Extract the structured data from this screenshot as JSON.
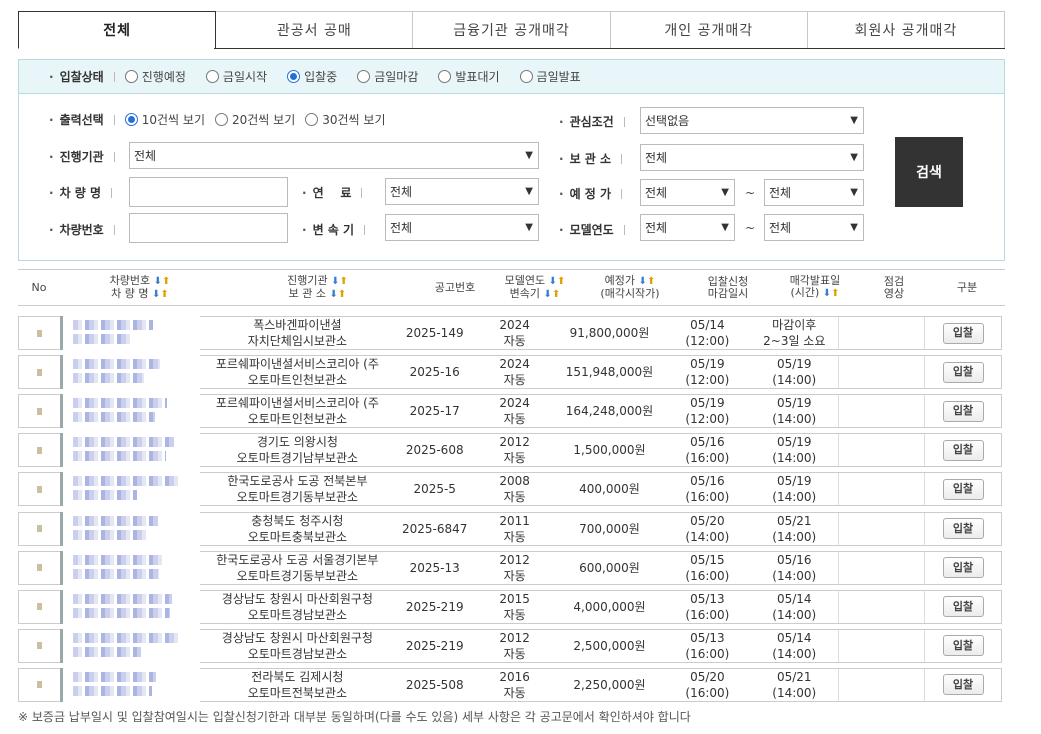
{
  "tabs": [
    "전체",
    "관공서 공매",
    "금융기관 공개매각",
    "개인 공개매각",
    "회원사 공개매각"
  ],
  "status": {
    "label": "입찰상태",
    "options": [
      "진행예정",
      "금일시작",
      "입찰중",
      "금일마감",
      "발표대기",
      "금일발표"
    ],
    "selected": "입찰중"
  },
  "filters": {
    "output_label": "출력선택",
    "output_options": [
      "10건씩 보기",
      "20건씩 보기",
      "30건씩 보기"
    ],
    "output_selected": "10건씩 보기",
    "interest_label": "관심조건",
    "interest_value": "선택없음",
    "agency_label": "진행기관",
    "agency_value": "전체",
    "storage_label": "보 관 소",
    "storage_value": "전체",
    "car_name_label": "차 량 명",
    "fuel_label": "연    료",
    "fuel_value": "전체",
    "price_label": "예 정 가",
    "price_from": "전체",
    "price_to": "전체",
    "car_no_label": "차량번호",
    "gear_label": "변 속 기",
    "gear_value": "전체",
    "model_year_label": "모델연도",
    "year_from": "전체",
    "year_to": "전체",
    "tilde": "~",
    "search_label": "검색"
  },
  "table": {
    "headers": {
      "no": "No",
      "car_no": "차량번호",
      "car_name": "차 량 명",
      "agency": "진행기관",
      "storage": "보 관 소",
      "notice": "공고번호",
      "model_year": "모델연도",
      "gear": "변속기",
      "price": "예정가",
      "price_sub": "(매각시작가)",
      "bid_apply": "입찰신청",
      "deadline": "마감일시",
      "announce": "매각발표일",
      "announce_sub": "(시간)",
      "inspect": "점검",
      "video": "영상",
      "type": "구분"
    },
    "rows": [
      {
        "agency": "폭스바겐파이낸셜",
        "storage": "자치단체임시보관소",
        "notice": "2025-149",
        "year": "2024",
        "gear": "자동",
        "price": "91,800,000원",
        "deadline_date": "05/14",
        "deadline_time": "(12:00)",
        "announce_date": "마감이후",
        "announce_time": "2~3일 소요",
        "button": "입찰"
      },
      {
        "agency": "포르쉐파이낸셜서비스코리아 (주",
        "storage": "오토마트인천보관소",
        "notice": "2025-16",
        "year": "2024",
        "gear": "자동",
        "price": "151,948,000원",
        "deadline_date": "05/19",
        "deadline_time": "(12:00)",
        "announce_date": "05/19",
        "announce_time": "(14:00)",
        "button": "입찰"
      },
      {
        "agency": "포르쉐파이낸셜서비스코리아 (주",
        "storage": "오토마트인천보관소",
        "notice": "2025-17",
        "year": "2024",
        "gear": "자동",
        "price": "164,248,000원",
        "deadline_date": "05/19",
        "deadline_time": "(12:00)",
        "announce_date": "05/19",
        "announce_time": "(14:00)",
        "button": "입찰"
      },
      {
        "agency": "경기도 의왕시청",
        "storage": "오토마트경기남부보관소",
        "notice": "2025-608",
        "year": "2012",
        "gear": "자동",
        "price": "1,500,000원",
        "deadline_date": "05/16",
        "deadline_time": "(16:00)",
        "announce_date": "05/19",
        "announce_time": "(14:00)",
        "button": "입찰"
      },
      {
        "agency": "한국도로공사 도공 전북본부",
        "storage": "오토마트경기동부보관소",
        "notice": "2025-5",
        "year": "2008",
        "gear": "자동",
        "price": "400,000원",
        "deadline_date": "05/16",
        "deadline_time": "(16:00)",
        "announce_date": "05/19",
        "announce_time": "(14:00)",
        "button": "입찰"
      },
      {
        "agency": "충청북도 청주시청",
        "storage": "오토마트충북보관소",
        "notice": "2025-6847",
        "year": "2011",
        "gear": "자동",
        "price": "700,000원",
        "deadline_date": "05/20",
        "deadline_time": "(14:00)",
        "announce_date": "05/21",
        "announce_time": "(14:00)",
        "button": "입찰"
      },
      {
        "agency": "한국도로공사 도공 서울경기본부",
        "storage": "오토마트경기동부보관소",
        "notice": "2025-13",
        "year": "2012",
        "gear": "자동",
        "price": "600,000원",
        "deadline_date": "05/15",
        "deadline_time": "(16:00)",
        "announce_date": "05/16",
        "announce_time": "(14:00)",
        "button": "입찰"
      },
      {
        "agency": "경상남도 창원시 마산회원구청",
        "storage": "오토마트경남보관소",
        "notice": "2025-219",
        "year": "2015",
        "gear": "자동",
        "price": "4,000,000원",
        "deadline_date": "05/13",
        "deadline_time": "(16:00)",
        "announce_date": "05/14",
        "announce_time": "(14:00)",
        "button": "입찰"
      },
      {
        "agency": "경상남도 창원시 마산회원구청",
        "storage": "오토마트경남보관소",
        "notice": "2025-219",
        "year": "2012",
        "gear": "자동",
        "price": "2,500,000원",
        "deadline_date": "05/13",
        "deadline_time": "(16:00)",
        "announce_date": "05/14",
        "announce_time": "(14:00)",
        "button": "입찰"
      },
      {
        "agency": "전라북도 김제시청",
        "storage": "오토마트전북보관소",
        "notice": "2025-508",
        "year": "2016",
        "gear": "자동",
        "price": "2,250,000원",
        "deadline_date": "05/20",
        "deadline_time": "(16:00)",
        "announce_date": "05/21",
        "announce_time": "(14:00)",
        "button": "입찰"
      }
    ]
  },
  "footnote": "※ 보증금 납부일시 및 입찰참여일시는 입찰신청기한과 대부분 동일하며(다를 수도 있음) 세부 사항은 각 공고문에서 확인하셔야 합니다"
}
